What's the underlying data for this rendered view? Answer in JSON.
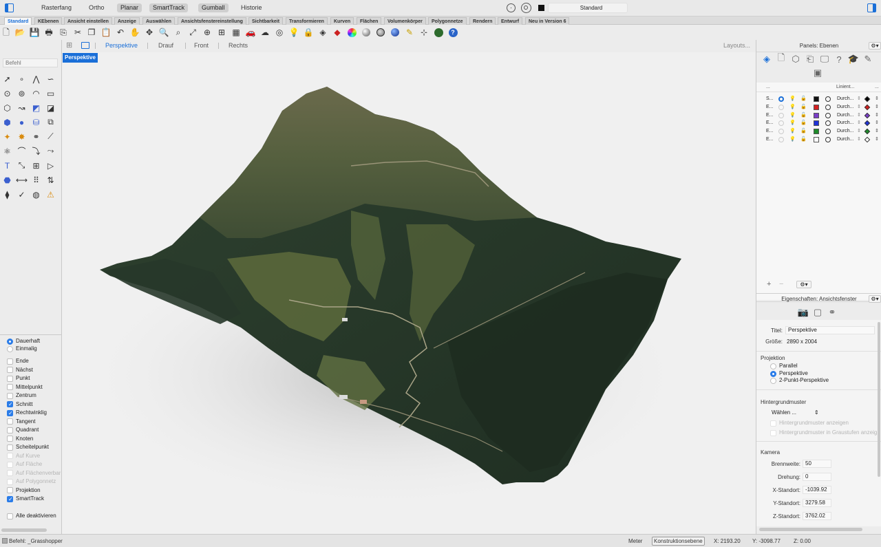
{
  "topbar": {
    "buttons": [
      {
        "label": "Rasterfang",
        "on": false
      },
      {
        "label": "Ortho",
        "on": false
      },
      {
        "label": "Planar",
        "on": true
      },
      {
        "label": "SmartTrack",
        "on": true
      },
      {
        "label": "Gumball",
        "on": true
      },
      {
        "label": "Historie",
        "on": false
      }
    ],
    "layer_value": "Standard"
  },
  "tabs": [
    "Standard",
    "KEbenen",
    "Ansicht einstellen",
    "Anzeige",
    "Auswählen",
    "Ansichtsfenstereinstellung",
    "Sichtbarkeit",
    "Transformieren",
    "Kurven",
    "Flächen",
    "Volumenkörper",
    "Polygonnetze",
    "Rendern",
    "Entwurf",
    "Neu in Version 6"
  ],
  "active_tab": "Standard",
  "toolbar_icons": [
    "new-icon",
    "open-icon",
    "save-icon",
    "print-icon",
    "import-icon",
    "cut-icon",
    "copy-icon",
    "paste-icon",
    "undo-icon",
    "pan-hand-icon",
    "move-icon",
    "zoom-icon",
    "zoom-window-icon",
    "zoom-extents-icon",
    "zoom-selected-icon",
    "grid-viewports-icon",
    "car-icon",
    "render-preview-icon",
    "target-icon",
    "light-bulb-icon",
    "lock-icon",
    "layer-palette-icon",
    "color-wheel-icon",
    "sphere-icon",
    "render-sphere-icon",
    "globe-icon",
    "pen-tool-icon",
    "gumball-icon",
    "grasshopper-icon",
    "help-icon"
  ],
  "command": {
    "placeholder": "Befehl"
  },
  "left_tools": [
    "select-arrow-icon",
    "point-icon",
    "polyline-icon",
    "curve-icon",
    "circle-icon",
    "ellipse-icon",
    "arc-icon",
    "rectangle-icon",
    "polygon-icon",
    "freeform-curve-icon",
    "surface-icon",
    "surface-edit-icon",
    "box-icon",
    "sphere-tool-icon",
    "cylinder-icon",
    "extrude-icon",
    "boolean-icon",
    "explode-icon",
    "join-icon",
    "split-icon",
    "group-icon",
    "fillet-icon",
    "offset-icon",
    "trim-icon",
    "text-icon",
    "dimension-icon",
    "array-icon",
    "align-icon",
    "mesh-icon",
    "measure-icon",
    "grid-tool-icon",
    "transform-icon",
    "analyze-icon",
    "check-icon",
    "render-tool-icon",
    "paint-icon"
  ],
  "osnap": {
    "mode": [
      {
        "label": "Dauerhaft",
        "on": true
      },
      {
        "label": "Einmalig",
        "on": false
      }
    ],
    "items": [
      {
        "label": "Ende",
        "checked": false,
        "disabled": false
      },
      {
        "label": "Nächst",
        "checked": false,
        "disabled": false
      },
      {
        "label": "Punkt",
        "checked": false,
        "disabled": false
      },
      {
        "label": "Mittelpunkt",
        "checked": false,
        "disabled": false
      },
      {
        "label": "Zentrum",
        "checked": false,
        "disabled": false
      },
      {
        "label": "Schnitt",
        "checked": true,
        "disabled": false
      },
      {
        "label": "Rechtwinklig",
        "checked": true,
        "disabled": false
      },
      {
        "label": "Tangent",
        "checked": false,
        "disabled": false
      },
      {
        "label": "Quadrant",
        "checked": false,
        "disabled": false
      },
      {
        "label": "Knoten",
        "checked": false,
        "disabled": false
      },
      {
        "label": "Scheitelpunkt",
        "checked": false,
        "disabled": false
      },
      {
        "label": "Auf Kurve",
        "checked": false,
        "disabled": true
      },
      {
        "label": "Auf Fläche",
        "checked": false,
        "disabled": true
      },
      {
        "label": "Auf Flächenverbar",
        "checked": false,
        "disabled": true
      },
      {
        "label": "Auf Polygonnetz",
        "checked": false,
        "disabled": true
      },
      {
        "label": "Projektion",
        "checked": false,
        "disabled": false
      },
      {
        "label": "SmartTrack",
        "checked": true,
        "disabled": false
      }
    ],
    "disable_all": "Alle deaktivieren"
  },
  "viewport_tabs": [
    "Perspektive",
    "Drauf",
    "Front",
    "Rechts"
  ],
  "active_viewport": "Perspektive",
  "layouts_label": "Layouts...",
  "viewport": {
    "label": "Perspektive"
  },
  "layers_panel": {
    "title": "Panels: Ebenen",
    "icons": [
      "layers-icon",
      "document-icon",
      "cube-icon",
      "page-icon",
      "display-icon",
      "help-circle-icon",
      "graduation-icon",
      "pen-icon",
      "named-view-icon"
    ],
    "col_name": "...",
    "col_linetype": "Linient...",
    "col_more": "...",
    "rows": [
      {
        "name": "S...",
        "current": true,
        "color": "#111111",
        "linetype": "Durch...",
        "print_color": "#000000",
        "print_fill": true
      },
      {
        "name": "E...",
        "current": false,
        "color": "#d42020",
        "linetype": "Durch...",
        "print_color": "#d42020",
        "print_fill": true
      },
      {
        "name": "E...",
        "current": false,
        "color": "#7a3ec8",
        "linetype": "Durch...",
        "print_color": "#7a3ec8",
        "print_fill": true
      },
      {
        "name": "E...",
        "current": false,
        "color": "#1f33d8",
        "linetype": "Durch...",
        "print_color": "#1f33d8",
        "print_fill": true
      },
      {
        "name": "E...",
        "current": false,
        "color": "#1e8a2a",
        "linetype": "Durch...",
        "print_color": "#1e8a2a",
        "print_fill": true
      },
      {
        "name": "E...",
        "current": false,
        "color": "#ffffff",
        "linetype": "Durch...",
        "print_color": "#ffffff",
        "print_fill": false
      }
    ],
    "footer": {
      "add": "+",
      "remove": "−"
    }
  },
  "properties_panel": {
    "title": "Eigenschaften: Ansichtsfenster",
    "icons": [
      "camera-icon",
      "frame-icon",
      "link-icon"
    ],
    "title_label": "Titel:",
    "title_value": "Perspektive",
    "size_label": "Größe:",
    "size_value": "2890 x 2004",
    "projection_label": "Projektion",
    "projections": [
      {
        "label": "Parallel",
        "on": false
      },
      {
        "label": "Perspektive",
        "on": true
      },
      {
        "label": "2-Punkt-Perspektive",
        "on": false
      }
    ],
    "background_label": "Hintergrundmuster",
    "background_choose": "Wählen ...",
    "background_show": "Hintergrundmuster anzeigen",
    "background_gray": "Hintergrundmuster in Graustufen anzeig",
    "camera_label": "Kamera",
    "camera": [
      {
        "label": "Brennweite:",
        "value": "50"
      },
      {
        "label": "Drehung:",
        "value": "0"
      },
      {
        "label": "X-Standort:",
        "value": "-1039.92"
      },
      {
        "label": "Y-Standort:",
        "value": "3279.58"
      },
      {
        "label": "Z-Standort:",
        "value": "3762.02"
      }
    ]
  },
  "status": {
    "command": "Befehl: _Grasshopper",
    "unit": "Meter",
    "plane": "Konstruktionsebene",
    "x": "X: 2193.20",
    "y": "Y: -3098.77",
    "z": "Z: 0.00"
  },
  "colors": {
    "accent": "#1a6fd8",
    "forest": "#2b3f2a",
    "meadow": "#5d6b3c"
  }
}
